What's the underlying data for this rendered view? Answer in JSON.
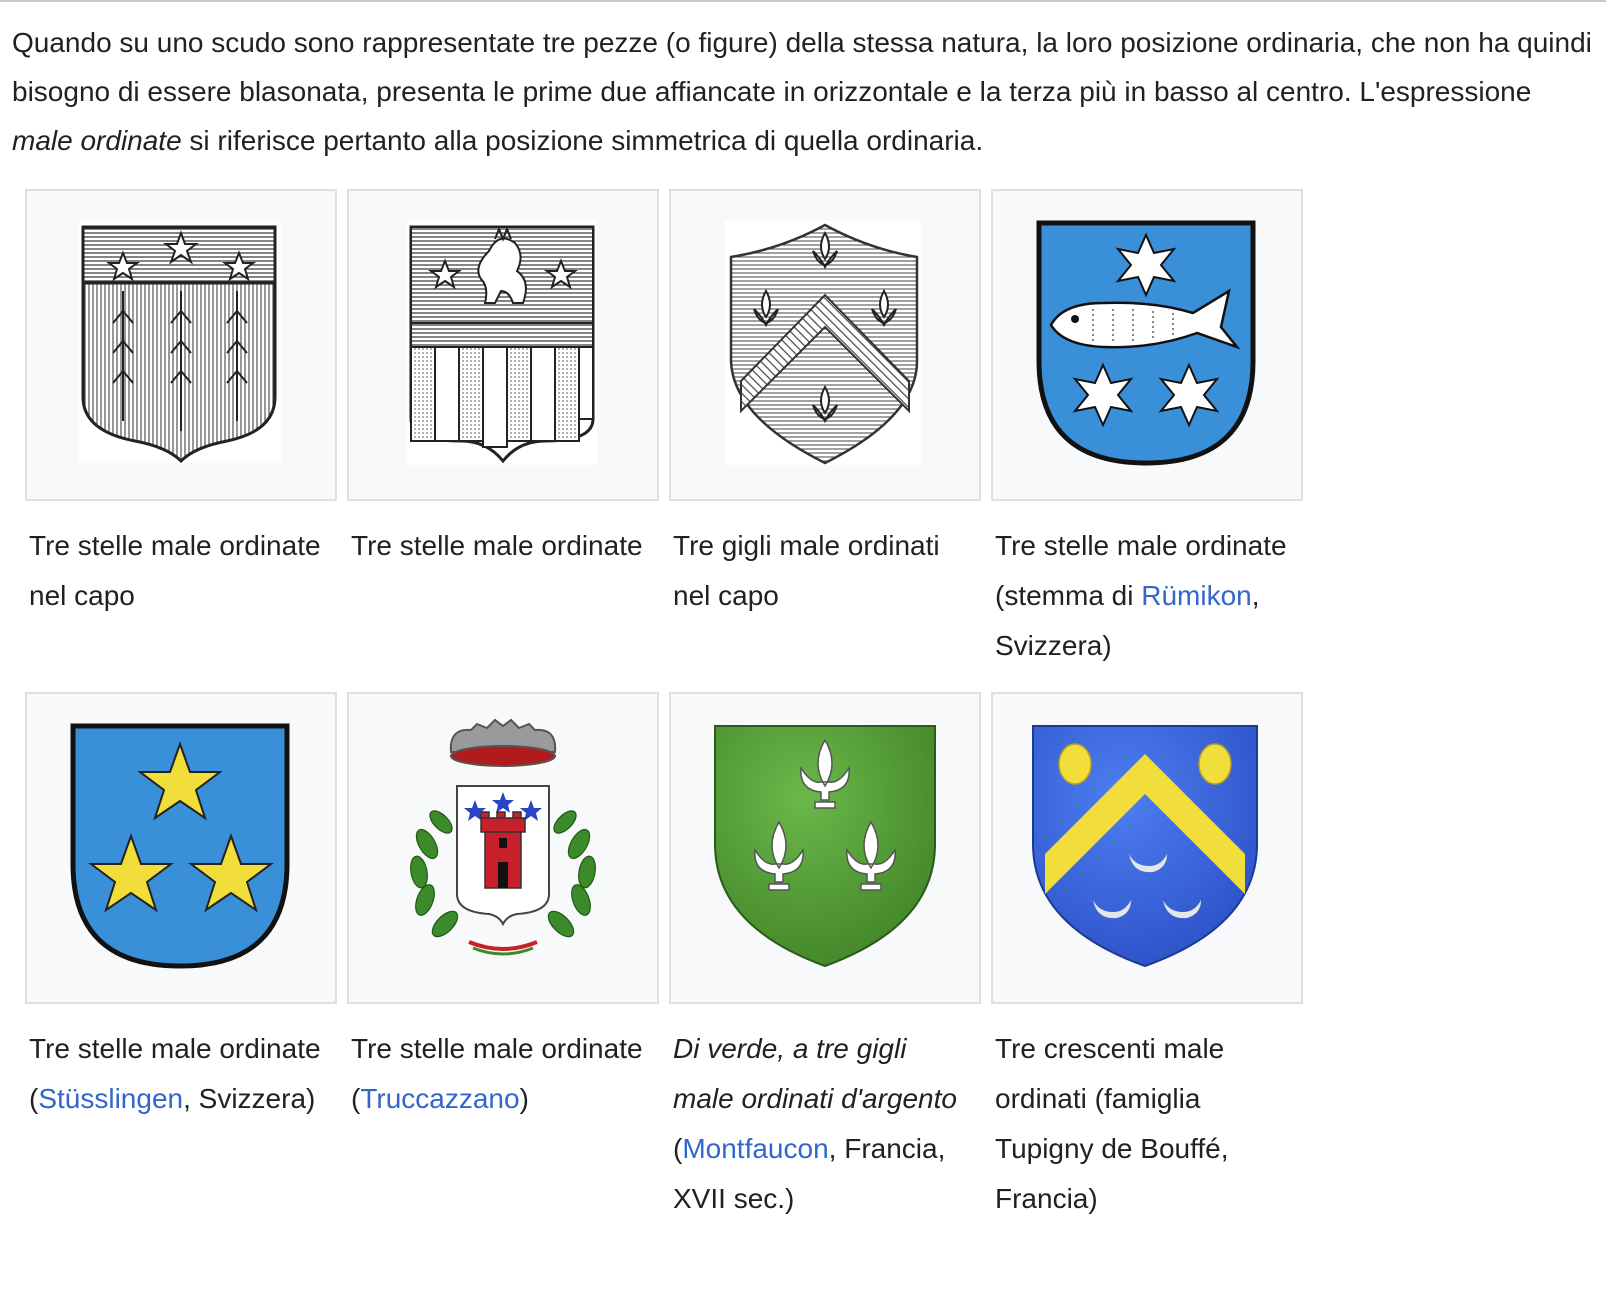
{
  "intro": {
    "before": "Quando su uno scudo sono rappresentate tre pezze (o figure) della stessa natura, la loro posizione ordinaria, che non ha quindi bisogno di essere blasonata, presenta le prime due affiancate in orizzontale e la terza più in basso al centro. L'espressione ",
    "em": "male ordinate",
    "after": " si riferisce pertanto alla posizione simmetrica di quella ordinaria."
  },
  "items": [
    {
      "icon": "shield-engraving-three-stars-in-chief",
      "caption": "Tre stelle male ordinate nel capo"
    },
    {
      "icon": "shield-engraving-lion-stars",
      "caption": "Tre stelle male ordinate"
    },
    {
      "icon": "shield-engraving-chevron-lilies",
      "caption": "Tre gigli male ordinati nel capo"
    },
    {
      "icon": "shield-rumikon",
      "caption_before": "Tre stelle male ordinate (stemma di ",
      "link": "Rümikon",
      "caption_after": ", Svizzera)"
    },
    {
      "icon": "shield-stusslingen",
      "caption_before": "Tre stelle male ordinate (",
      "link": "Stüsslingen",
      "caption_after": ", Svizzera)"
    },
    {
      "icon": "shield-truccazzano",
      "caption_before": "Tre stelle male ordinate (",
      "link": "Truccazzano",
      "caption_after": ")"
    },
    {
      "icon": "shield-montfaucon",
      "caption_italic": "Di verde, a tre gigli male ordinati d'argento",
      "caption_before": " (",
      "link": "Montfaucon",
      "caption_after": ", Francia, XVII sec.)"
    },
    {
      "icon": "shield-tupigny",
      "caption": "Tre crescenti male ordinati (famiglia Tupigny de Bouffé, Francia)"
    }
  ],
  "colors": {
    "link": "#3366cc",
    "text": "#202122",
    "sky_blue": "#3a8fd9",
    "royal_blue": "#2f5bd6",
    "green": "#4d9a2e",
    "gold": "#f2de3a",
    "red": "#c8202a"
  }
}
